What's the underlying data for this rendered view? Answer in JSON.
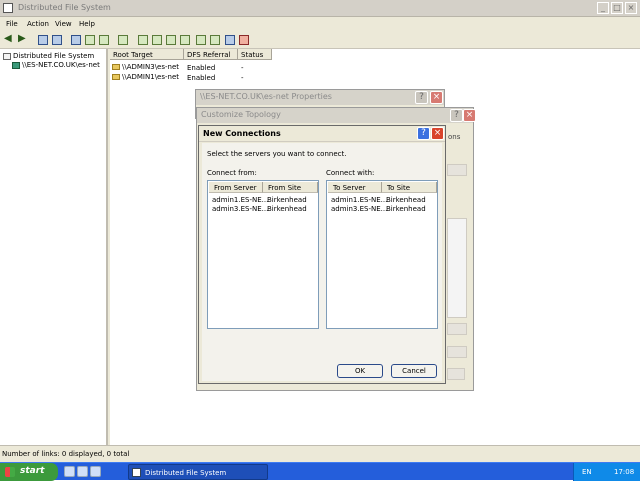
{
  "window": {
    "title": "Distributed File System",
    "menu": [
      "File",
      "Action",
      "View",
      "Help"
    ]
  },
  "tree": {
    "root": "Distributed File System",
    "child": "\\\\ES-NET.CO.UK\\es-net"
  },
  "list": {
    "columns": [
      "Root Target",
      "DFS Referral",
      "Status"
    ],
    "rows": [
      {
        "target": "\\\\ADMIN3\\es-net",
        "referral": "Enabled",
        "status": "-"
      },
      {
        "target": "\\\\ADMIN1\\es-net",
        "referral": "Enabled",
        "status": "-"
      }
    ]
  },
  "status_text": "Number of links: 0 displayed, 0 total",
  "dialogs": {
    "properties_title": "\\\\ES-NET.CO.UK\\es-net Properties",
    "properties_partial": "ons",
    "topology_title": "Customize Topology",
    "new_conn": {
      "title": "New Connections",
      "instruction": "Select the servers you want to connect.",
      "from_label": "Connect from:",
      "with_label": "Connect with:",
      "from_cols": [
        "From Server",
        "From Site"
      ],
      "with_cols": [
        "To Server",
        "To Site"
      ],
      "from_rows": [
        {
          "server": "admin1.ES-NE...",
          "site": "Birkenhead"
        },
        {
          "server": "admin3.ES-NE...",
          "site": "Birkenhead"
        }
      ],
      "with_rows": [
        {
          "server": "admin1.ES-NE...",
          "site": "Birkenhead"
        },
        {
          "server": "admin3.ES-NE...",
          "site": "Birkenhead"
        }
      ],
      "ok_label": "OK",
      "cancel_label": "Cancel"
    }
  },
  "taskbar": {
    "start_label": "start",
    "task_label": "Distributed File System",
    "lang": "EN",
    "clock": "17:08"
  }
}
